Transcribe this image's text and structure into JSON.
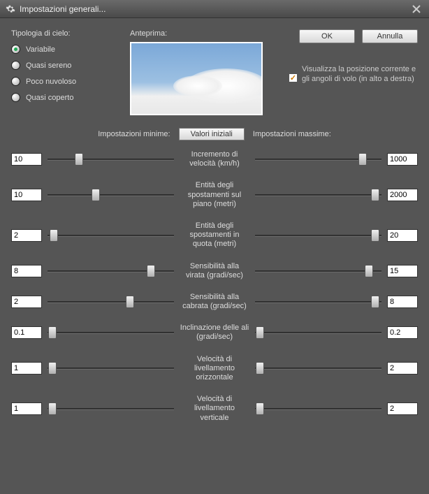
{
  "window": {
    "title": "Impostazioni generali..."
  },
  "sky": {
    "label": "Tipologia di cielo:",
    "options": [
      {
        "label": "Variabile",
        "checked": true
      },
      {
        "label": "Quasi sereno",
        "checked": false
      },
      {
        "label": "Poco nuvoloso",
        "checked": false
      },
      {
        "label": "Quasi coperto",
        "checked": false
      }
    ]
  },
  "preview": {
    "label": "Anteprima:"
  },
  "buttons": {
    "ok": "OK",
    "cancel": "Annulla",
    "defaults": "Valori iniziali"
  },
  "checkbox": {
    "label": "Visualizza la posizione corrente e gli angoli di volo (in alto a destra)",
    "checked": true
  },
  "headers": {
    "min": "Impostazioni minime:",
    "max": "Impostazioni massime:"
  },
  "params": [
    {
      "label": "Incremento di velocità (km/h)",
      "min": "10",
      "max": "1000",
      "minPos": 25,
      "maxPos": 85
    },
    {
      "label": "Entità degli spostamenti sul piano (metri)",
      "min": "10",
      "max": "2000",
      "minPos": 38,
      "maxPos": 95
    },
    {
      "label": "Entità degli spostamenti in quota  (metri)",
      "min": "2",
      "max": "20",
      "minPos": 5,
      "maxPos": 95
    },
    {
      "label": "Sensibilità alla virata (gradi/sec)",
      "min": "8",
      "max": "15",
      "minPos": 82,
      "maxPos": 90
    },
    {
      "label": "Sensibilità alla cabrata (gradi/sec)",
      "min": "2",
      "max": "8",
      "minPos": 65,
      "maxPos": 95
    },
    {
      "label": "Inclinazione delle ali (gradi/sec)",
      "min": "0.1",
      "max": "0.2",
      "minPos": 4,
      "maxPos": 4
    },
    {
      "label": "Velocità di livellamento orizzontale",
      "min": "1",
      "max": "2",
      "minPos": 4,
      "maxPos": 4
    },
    {
      "label": "Velocità di livellamento verticale",
      "min": "1",
      "max": "2",
      "minPos": 4,
      "maxPos": 4
    }
  ]
}
